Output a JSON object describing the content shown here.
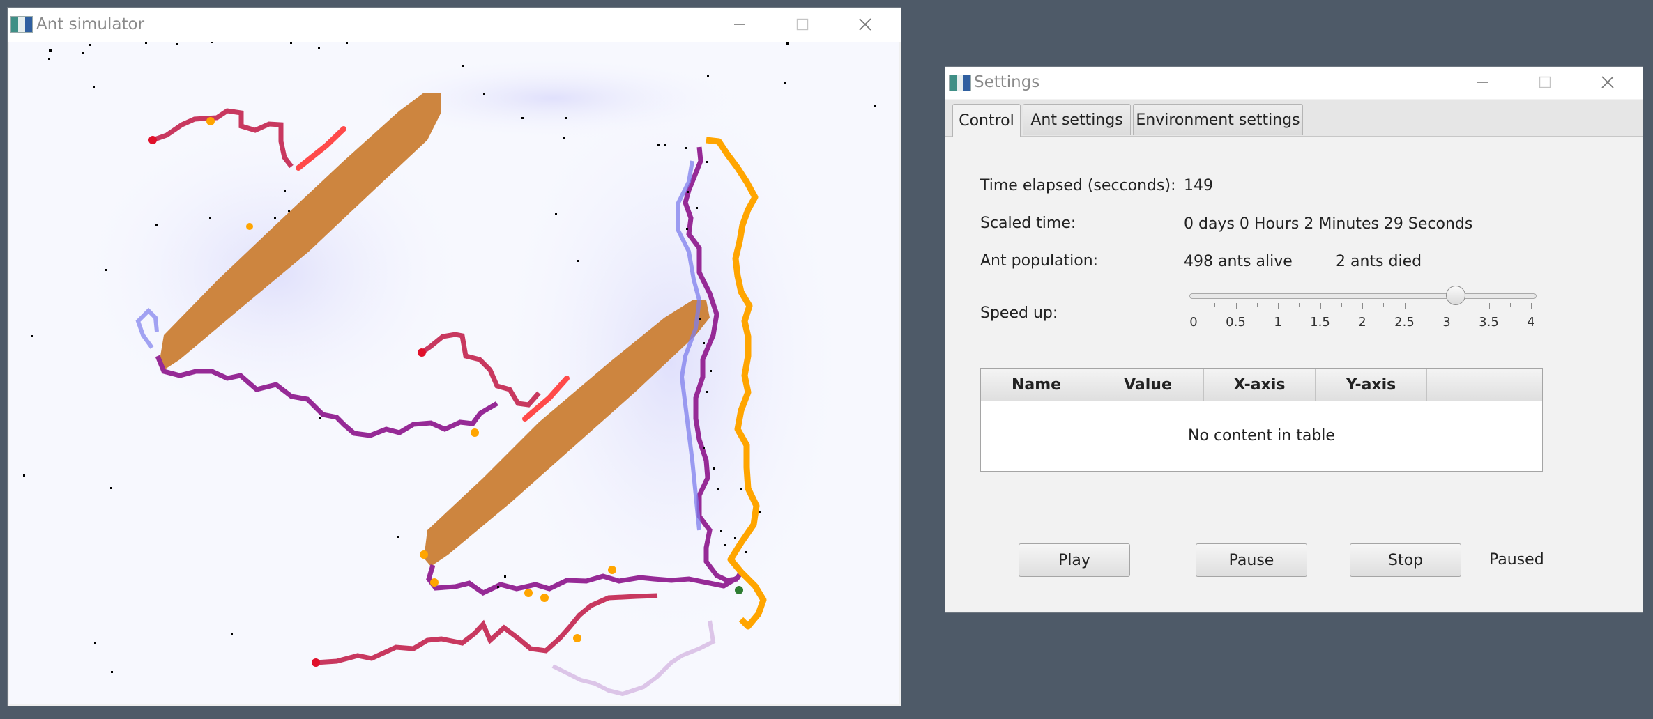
{
  "ant_window": {
    "title": "Ant simulator",
    "colors": {
      "food": "#cd853f",
      "food_edge": "#ff4a4a",
      "trail_red": "#c8385f",
      "trail_purple": "#962a96",
      "trail_orange": "#ffa500",
      "trail_blue": "#7d7dec",
      "ant": "#000000",
      "nest": "#2e7d32"
    }
  },
  "settings_window": {
    "title": "Settings",
    "tabs": [
      "Control",
      "Ant settings",
      "Environment settings"
    ],
    "active_tab": "Control",
    "time_elapsed": {
      "label": "Time elapsed (secconds):",
      "value": "149"
    },
    "scaled_time": {
      "label": "Scaled time:",
      "value": "0 days 0 Hours 2 Minutes 29 Seconds"
    },
    "population": {
      "label": "Ant population:",
      "alive": "498 ants alive",
      "died": "2 ants died"
    },
    "speed": {
      "label": "Speed up:",
      "value": 3.1,
      "min": 0,
      "max": 4,
      "tick_labels": [
        "0",
        "0.5",
        "1",
        "1.5",
        "2",
        "2.5",
        "3",
        "3.5",
        "4"
      ]
    },
    "table": {
      "columns": [
        "Name",
        "Value",
        "X-axis",
        "Y-axis"
      ],
      "placeholder": "No content in table"
    },
    "buttons": {
      "play": "Play",
      "pause": "Pause",
      "stop": "Stop"
    },
    "status": "Paused"
  }
}
